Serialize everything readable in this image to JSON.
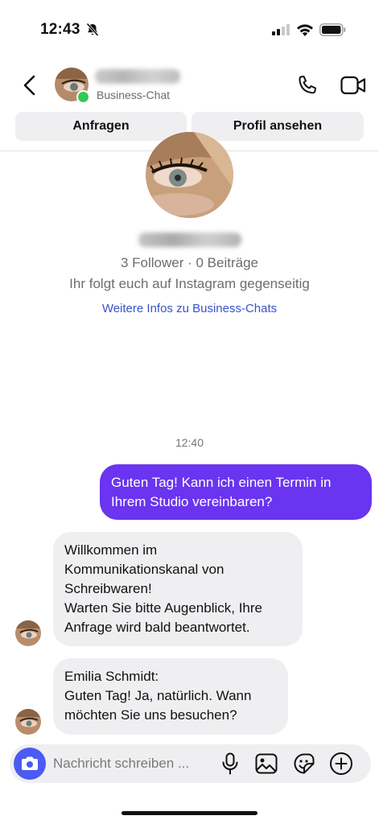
{
  "status_bar": {
    "time": "12:43"
  },
  "header": {
    "subtitle": "Business-Chat",
    "buttons": {
      "request": "Anfragen",
      "view_profile": "Profil ansehen"
    }
  },
  "profile": {
    "stats": "3 Follower · 0 Beiträge",
    "mutual": "Ihr folgt euch auf Instagram gegenseitig",
    "info_link": "Weitere Infos zu Business-Chats"
  },
  "chat": {
    "timestamp": "12:40",
    "messages": [
      {
        "direction": "out",
        "lines": [
          "Guten Tag! Kann ich einen Termin in",
          "Ihrem Studio vereinbaren?"
        ]
      },
      {
        "direction": "in",
        "lines": [
          "Willkommen im",
          "Kommunikationskanal von",
          "Schreibwaren!",
          "Warten Sie bitte Augenblick, Ihre",
          "Anfrage wird bald beantwortet."
        ]
      },
      {
        "direction": "in",
        "lines": [
          "Emilia Schmidt:",
          "Guten Tag! Ja, natürlich. Wann",
          "möchten Sie uns besuchen?"
        ]
      }
    ]
  },
  "composer": {
    "placeholder": "Nachricht schreiben ..."
  },
  "colors": {
    "accent": "#6a34f0",
    "camera": "#4b5bf3",
    "online": "#35c759",
    "link": "#3a54c9"
  },
  "icons": [
    "bell-muted-icon",
    "signal-icon",
    "wifi-icon",
    "battery-icon",
    "back-icon",
    "phone-icon",
    "video-icon",
    "camera-icon",
    "mic-icon",
    "gallery-icon",
    "sticker-icon",
    "plus-icon"
  ]
}
